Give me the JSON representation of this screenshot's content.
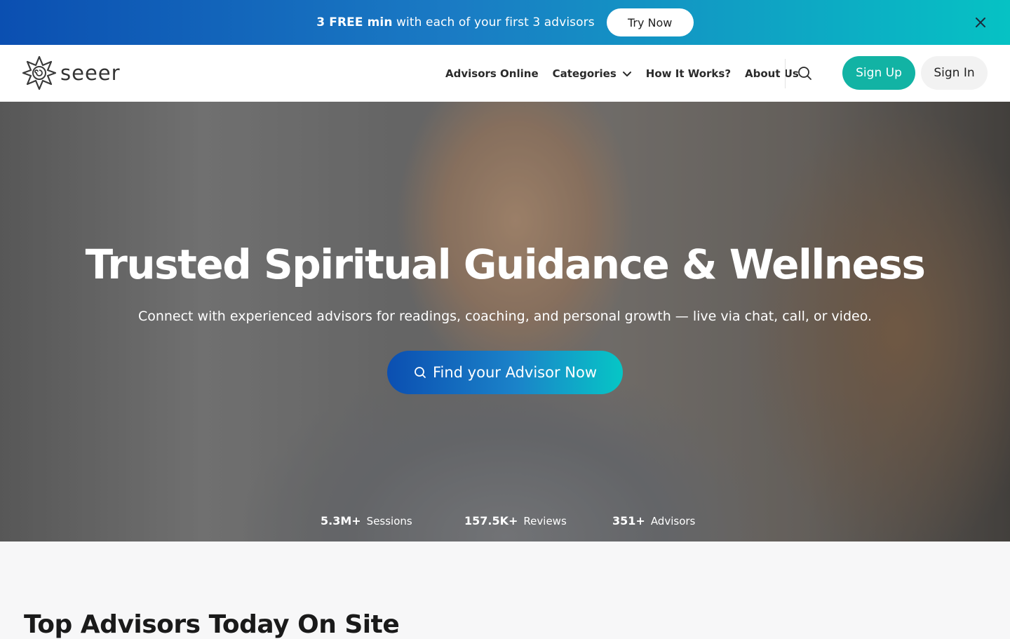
{
  "promo": {
    "bold_text": "3 FREE min",
    "text": " with each of your first 3 advisors",
    "button_label": "Try Now",
    "close_icon": "close-icon"
  },
  "header": {
    "logo_text": "seeer",
    "nav": [
      {
        "label": "Advisors Online"
      },
      {
        "label": "Categories"
      },
      {
        "label": "How It Works?"
      },
      {
        "label": "About Us"
      }
    ],
    "search_icon": "search-icon",
    "signup_label": "Sign Up",
    "signin_label": "Sign In"
  },
  "hero": {
    "title": "Trusted Spiritual Guidance & Wellness",
    "subtitle": "Connect with experienced advisors for readings, coaching, and personal growth — live via chat, call, or video.",
    "cta_label": "Find your Advisor Now",
    "stats": [
      {
        "value": "5.3M+",
        "label": "Sessions"
      },
      {
        "value": "157.5K+",
        "label": "Reviews"
      },
      {
        "value": "351+",
        "label": "Advisors"
      }
    ]
  },
  "section": {
    "title": "Top Advisors Today On Site"
  },
  "colors": {
    "brand_teal": "#12b3a4",
    "gradient_start": "#0b4fb1",
    "gradient_end": "#06c2c4"
  }
}
